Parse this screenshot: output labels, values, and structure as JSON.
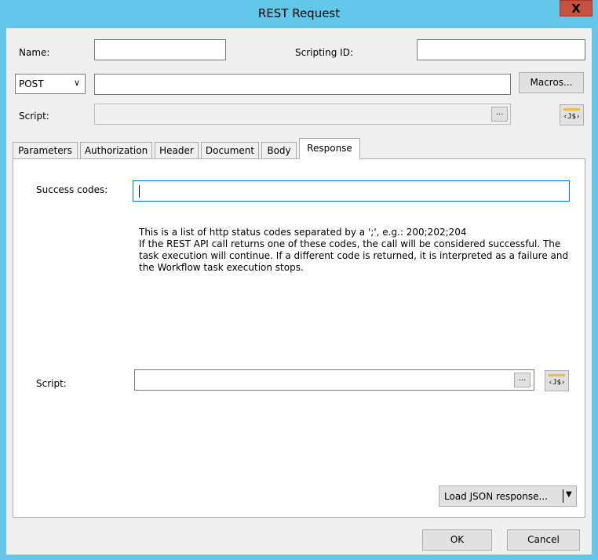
{
  "window": {
    "title": "REST Request",
    "close_glyph": "X"
  },
  "form": {
    "name_label": "Name:",
    "name_value": "",
    "scripting_id_label": "Scripting ID:",
    "scripting_id_value": "",
    "method": "POST",
    "method_chevron": "∨",
    "url_value": "",
    "macros_label": "Macros...",
    "script_label": "Script:",
    "script_value": "",
    "ellipsis": "...",
    "js_label": "‹J$›"
  },
  "tabs": [
    {
      "label": "Parameters"
    },
    {
      "label": "Authorization"
    },
    {
      "label": "Header"
    },
    {
      "label": "Document"
    },
    {
      "label": "Body"
    },
    {
      "label": "Response",
      "active": true
    }
  ],
  "response": {
    "success_codes_label": "Success codes:",
    "success_codes_value": "",
    "description_line1": "This is a list of http status codes separated by a ';', e.g.: 200;202;204",
    "description_line2": "If the REST API call returns one of these codes, the call will be considered successful. The task execution will continue. If a different code is returned, it is interpreted as a failure and the Workflow task execution stops.",
    "script_label": "Script:",
    "script_value": "",
    "load_json_label": "Load JSON response...",
    "load_json_arrow": "▼"
  },
  "buttons": {
    "ok": "OK",
    "cancel": "Cancel"
  },
  "icons": {
    "close": "close-icon",
    "chevron": "chevron-down-icon",
    "js": "javascript-icon",
    "dropdown": "dropdown-arrow-icon"
  },
  "colors": {
    "titlebar": "#63c7ea",
    "close": "#c7503f",
    "js_accent": "#f3b83c",
    "focus_border": "#0078d7"
  }
}
